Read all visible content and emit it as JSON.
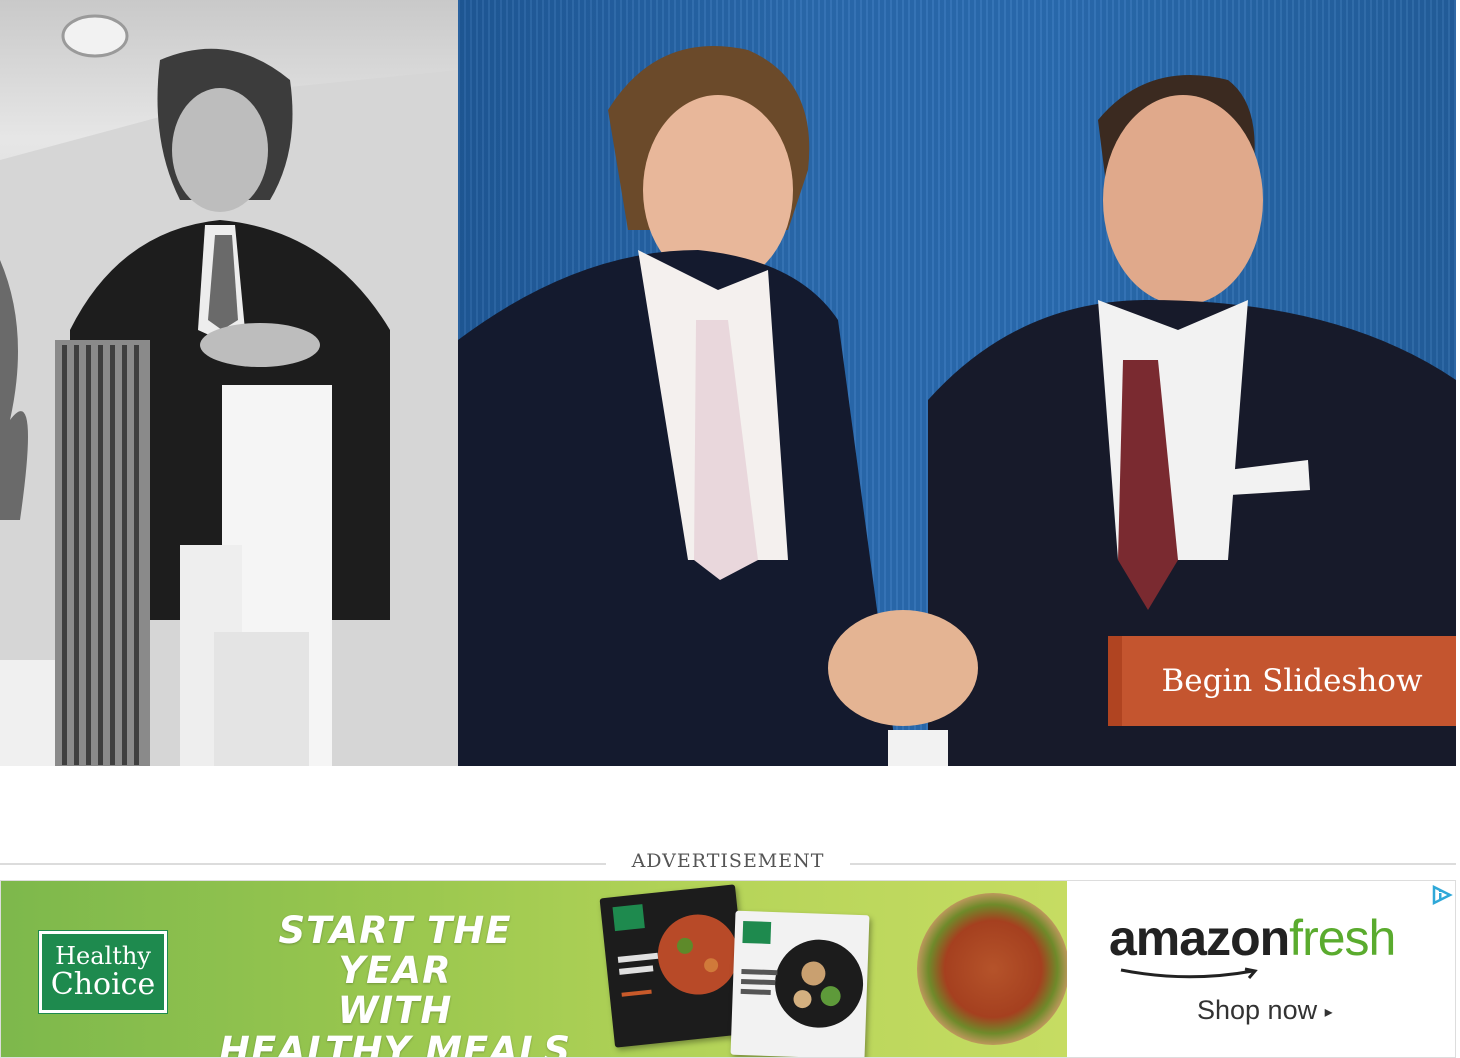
{
  "slideshow": {
    "button_label": "Begin Slideshow"
  },
  "ad": {
    "label": "ADVERTISEMENT",
    "brand_logo": {
      "line1": "Healthy",
      "line2": "Choice"
    },
    "headline_lines": [
      "START THE YEAR",
      "WITH",
      "HEALTHY MEALS"
    ],
    "retailer": {
      "part1": "amazon",
      "part2": "fresh"
    },
    "cta": "Shop now",
    "cta_arrow": "▸",
    "adchoices_icon": "adchoices-icon"
  },
  "colors": {
    "slideshow_button": "#c4552f",
    "ad_green": "#9cc84f",
    "healthy_choice_green": "#1e8a4e",
    "amazon_fresh_green": "#5aab2e"
  }
}
